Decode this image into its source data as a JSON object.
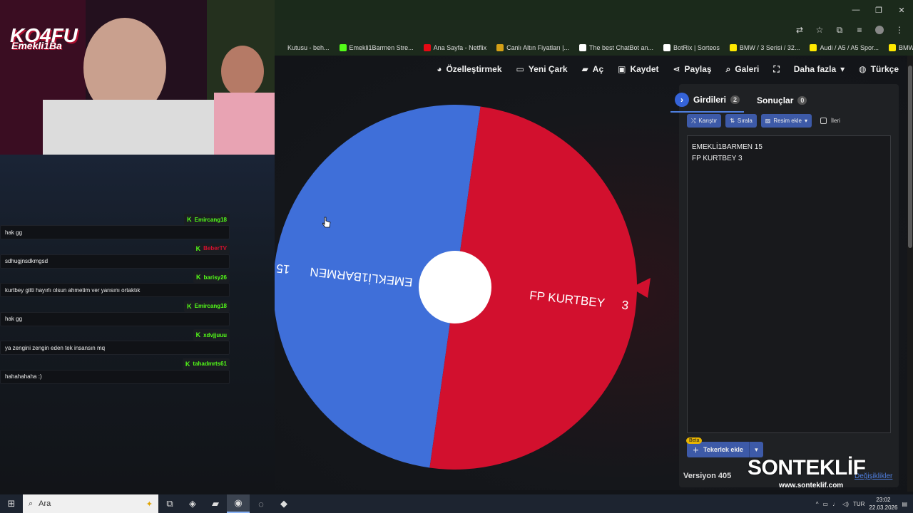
{
  "window": {
    "controls": [
      "—",
      "❐",
      "✕"
    ]
  },
  "bookmarks": [
    {
      "label": "Kutusu - beh...",
      "icon": "doc-icon",
      "color": ""
    },
    {
      "label": "Emekli1Barmen Stre...",
      "icon": "kick-icon",
      "color": "#53fc18"
    },
    {
      "label": "Ana Sayfa - Netflix",
      "icon": "netflix-icon",
      "color": "#e50914"
    },
    {
      "label": "Canlı Altın Fiyatları |...",
      "icon": "gold-icon",
      "color": "#d4a017"
    },
    {
      "label": "The best ChatBot an...",
      "icon": "chatbot-icon",
      "color": "#ffffff"
    },
    {
      "label": "BotRix | Sorteos",
      "icon": "botrix-icon",
      "color": "#ffffff"
    },
    {
      "label": "BMW / 3 Serisi / 32...",
      "icon": "sahibinden-icon",
      "color": "#ffe800"
    },
    {
      "label": "Audi / A5 / A5 Spor...",
      "icon": "sahibinden-icon",
      "color": "#ffe800"
    },
    {
      "label": "BMW / 3 Serisi / 32...",
      "icon": "sahibinden-icon",
      "color": "#ffe800"
    }
  ],
  "nav": {
    "customize": "Özelleştirmek",
    "new_wheel": "Yeni Çark",
    "open": "Aç",
    "save": "Kaydet",
    "share": "Paylaş",
    "gallery": "Galeri",
    "more": "Daha fazla",
    "language": "Türkçe"
  },
  "wheel": {
    "segments": [
      {
        "label": "EMEKLİ1BARMEN",
        "value": "15",
        "color": "#3f6fd9"
      },
      {
        "label": "FP KURTBEY",
        "value": "3",
        "color": "#d2102e"
      }
    ],
    "rotation_deg": 0
  },
  "panel": {
    "tabs": [
      {
        "label": "Girdileri",
        "count": "2",
        "active": true
      },
      {
        "label": "Sonuçlar",
        "count": "0",
        "active": false
      }
    ],
    "toolbar": {
      "shuffle": "Karıştır",
      "sort": "Sırala",
      "add_image": "Resim ekle",
      "advanced": "İleri"
    },
    "entries": [
      "EMEKLİ1BARMEN 15",
      "FP KURTBEY 3"
    ],
    "beta_badge": "Beta",
    "add_wheels": "Tekerlek ekle",
    "version": "Versiyon 405",
    "changes_link": "Değişiklikler"
  },
  "stream": {
    "channel_logo": "KO4FU",
    "channel_sub": "Emekli1Ba"
  },
  "chat": [
    {
      "user": "Emircang18",
      "color": "#53fc18",
      "message": "hak gg"
    },
    {
      "user": "BeberTV",
      "color": "#d2102e",
      "message": "sdhugjnsdkmgsd"
    },
    {
      "user": "barisy26",
      "color": "#53fc18",
      "message": "kurtbey gitti hayırlı olsun ahmetim ver yarısını ortaktık"
    },
    {
      "user": "Emircang18",
      "color": "#53fc18",
      "message": "hak gg"
    },
    {
      "user": "xdvjjuuu",
      "color": "#53fc18",
      "message": "ya zengini zengin eden tek insansın mq"
    },
    {
      "user": "tahadmrts61",
      "color": "#53fc18",
      "message": "hahahahaha :)"
    }
  ],
  "watermark": {
    "brand": "SONTEKLİF",
    "url": "www.sonteklif.com"
  },
  "taskbar": {
    "search_placeholder": "Ara",
    "language": "TUR",
    "time": "23:02",
    "date": "22.03.2026"
  }
}
